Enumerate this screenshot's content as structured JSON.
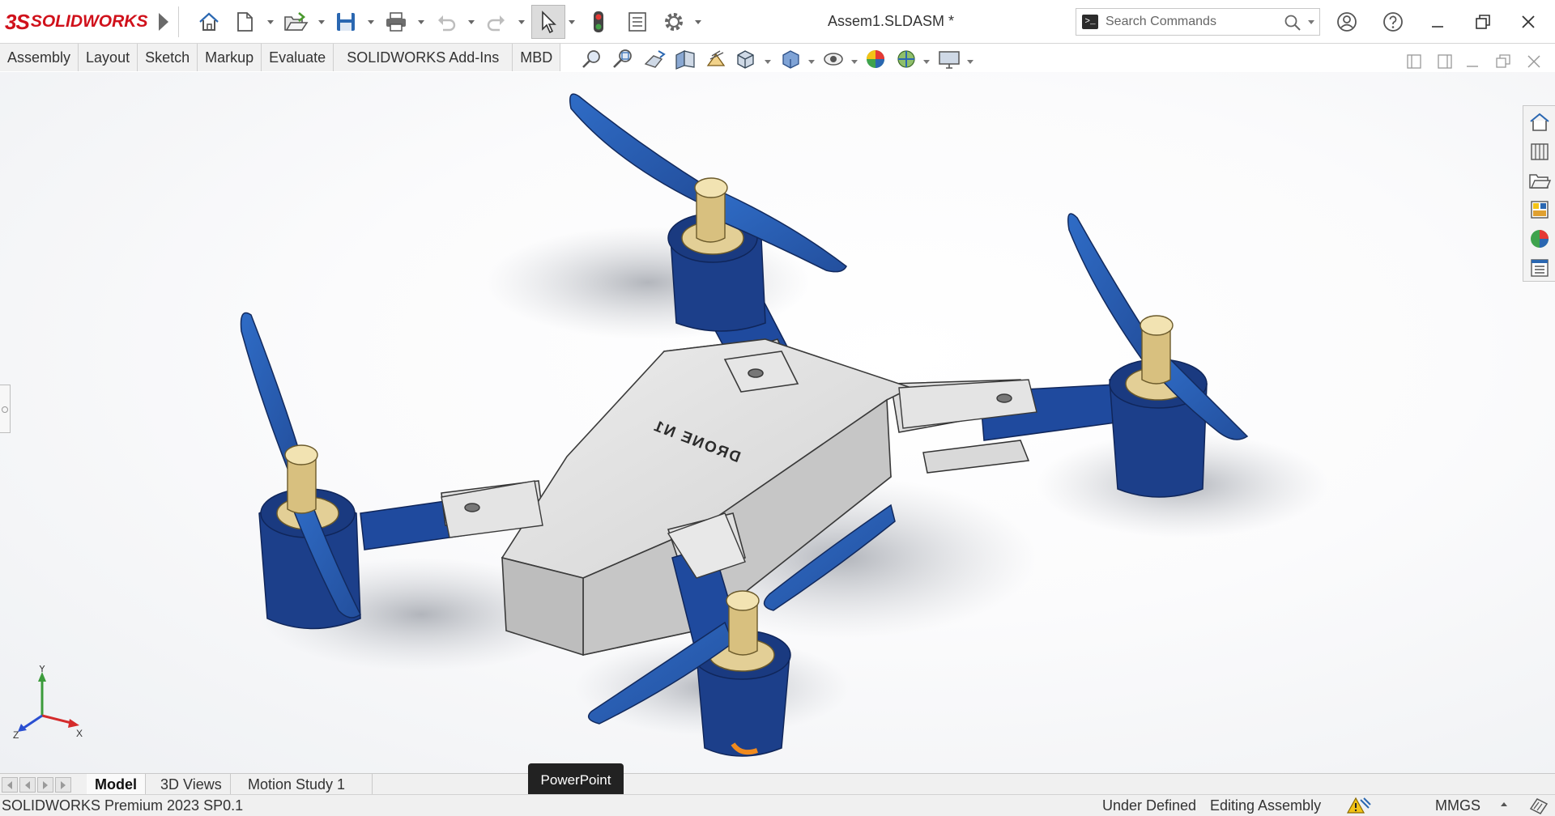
{
  "app": {
    "brand_mark": "3S",
    "brand_name": "SOLIDWORKS",
    "document_title": "Assem1.SLDASM *"
  },
  "search": {
    "placeholder": "Search Commands"
  },
  "command_tabs": [
    "Assembly",
    "Layout",
    "Sketch",
    "Markup",
    "Evaluate",
    "SOLIDWORKS Add-Ins",
    "MBD"
  ],
  "quick_access_icons": [
    "home-icon",
    "new-document-icon",
    "open-folder-icon",
    "save-icon",
    "print-icon",
    "undo-icon",
    "redo-icon",
    "select-icon",
    "rebuild-icon",
    "file-properties-icon",
    "options-icon"
  ],
  "view_toolbar_icons": [
    "zoom-to-fit-icon",
    "zoom-to-area-icon",
    "previous-view-icon",
    "section-view-icon",
    "dynamic-annotation-icon",
    "view-orientation-icon",
    "display-style-icon",
    "hide-show-items-icon",
    "edit-appearance-icon",
    "apply-scene-icon",
    "view-settings-icon"
  ],
  "task_pane_icons": [
    "solidworks-resources-icon",
    "design-library-icon",
    "file-explorer-icon",
    "view-palette-icon",
    "appearances-scenes-icon",
    "custom-properties-icon"
  ],
  "model": {
    "body_label": "DRONE N1",
    "triad_labels": {
      "x": "X",
      "y": "Y",
      "z": "Z"
    }
  },
  "bottom_tabs": [
    {
      "label": "Model",
      "active": true
    },
    {
      "label": "3D Views",
      "active": false
    },
    {
      "label": "Motion Study 1",
      "active": false
    }
  ],
  "tooltip": "PowerPoint",
  "status": {
    "product": "SOLIDWORKS Premium 2023 SP0.1",
    "definition": "Under Defined",
    "mode": "Editing Assembly",
    "units": "MMGS"
  },
  "colors": {
    "brand_red": "#d0111b",
    "propeller_blue": "#2a62b8",
    "arm_navy": "#1c3f8a",
    "body_gray": "#dcdcdc",
    "hub_gold": "#e3cf96",
    "accent_orange": "#f08a1e"
  }
}
